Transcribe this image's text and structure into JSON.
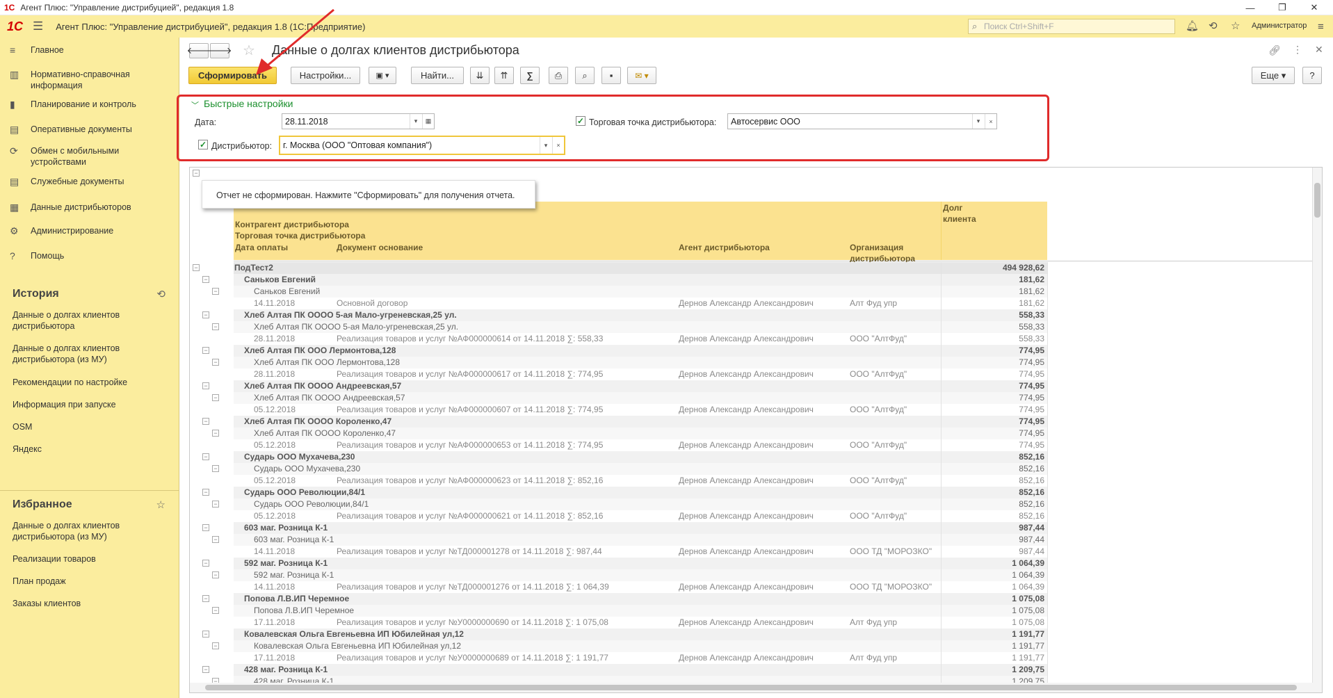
{
  "window": {
    "title": "Агент Плюс: \"Управление дистрибуцией\", редакция 1.8",
    "minimize": "—",
    "restore": "❐",
    "close": "✕"
  },
  "appbar": {
    "logo": "1С",
    "title": "Агент Плюс: \"Управление дистрибуцией\", редакция 1.8  (1С:Предприятие)",
    "search_placeholder": "Поиск Ctrl+Shift+F",
    "user": "Администратор"
  },
  "sidebar": {
    "nav": [
      {
        "label": "Главное",
        "icon": "≡"
      },
      {
        "label": "Нормативно-справочная информация",
        "icon": "▥"
      },
      {
        "label": "Планирование и контроль",
        "icon": "▮"
      },
      {
        "label": "Оперативные документы",
        "icon": "▤"
      },
      {
        "label": "Обмен с мобильными устройствами",
        "icon": "⟳"
      },
      {
        "label": "Служебные документы",
        "icon": "▤"
      },
      {
        "label": "Данные дистрибьюторов",
        "icon": "▦"
      },
      {
        "label": "Администрирование",
        "icon": "⚙"
      },
      {
        "label": "Помощь",
        "icon": "?"
      }
    ],
    "history_title": "История",
    "history": [
      "Данные о долгах клиентов дистрибьютора",
      "Данные о долгах клиентов дистрибьютора (из МУ)",
      "Рекомендации по настройке",
      "Информация при запуске",
      "OSM",
      "Яндекс"
    ],
    "favorites_title": "Избранное",
    "favorites": [
      "Данные о долгах клиентов дистрибьютора (из МУ)",
      "Реализации товаров",
      "План продаж",
      "Заказы клиентов"
    ]
  },
  "page": {
    "title": "Данные о долгах клиентов дистрибьютора",
    "btn_generate": "Сформировать",
    "btn_settings": "Настройки...",
    "btn_find": "Найти...",
    "btn_more": "Еще",
    "btn_help": "?"
  },
  "quick": {
    "title": "Быстрые настройки",
    "date_label": "Дата:",
    "date_value": "28.11.2018",
    "outlet_label": "Торговая точка дистрибьютора:",
    "outlet_value": "Автосервис ООО",
    "distributor_label": "Дистрибьютор:",
    "distributor_value": "г. Москва  (ООО \"Оптовая компания\")"
  },
  "report": {
    "tooltip": "Отчет не сформирован. Нажмите \"Сформировать\" для получения отчета.",
    "headers": {
      "h1": "Контрагент дистрибьютора",
      "h2": "Торговая точка дистрибьютора",
      "h3": "Дата оплаты",
      "h4": "Документ основание",
      "h5": "Агент дистрибьютора",
      "h6": "Организация дистрибьютора",
      "h7": "Долг клиента"
    },
    "rows": [
      {
        "lvl": 0,
        "c1": "ПодТест2",
        "c2": "",
        "c3": "",
        "c4": "",
        "amt": "494 928,62"
      },
      {
        "lvl": 1,
        "c1": "Саньков Евгений",
        "c2": "",
        "c3": "",
        "c4": "",
        "amt": "181,62"
      },
      {
        "lvl": 2,
        "c1": "Саньков Евгений",
        "c2": "",
        "c3": "",
        "c4": "",
        "amt": "181,62"
      },
      {
        "lvl": 3,
        "c1": "14.11.2018",
        "c2": "Основной договор",
        "c3": "Дернов Александр Александрович",
        "c4": "Алт Фуд упр",
        "amt": "181,62"
      },
      {
        "lvl": 1,
        "c1": "Хлеб Алтая ПК ОООО 5-ая Мало-угреневская,25 ул.",
        "c2": "",
        "c3": "",
        "c4": "",
        "amt": "558,33"
      },
      {
        "lvl": 2,
        "c1": "Хлеб Алтая ПК ОООО 5-ая Мало-угреневская,25 ул.",
        "c2": "",
        "c3": "",
        "c4": "",
        "amt": "558,33"
      },
      {
        "lvl": 3,
        "c1": "28.11.2018",
        "c2": "Реализация товаров и услуг №АФ000000614 от 14.11.2018 ∑: 558,33",
        "c3": "Дернов Александр Александрович",
        "c4": "ООО \"АлтФуд\"",
        "amt": "558,33"
      },
      {
        "lvl": 1,
        "c1": "Хлеб Алтая ПК ООО Лермонтова,128",
        "c2": "",
        "c3": "",
        "c4": "",
        "amt": "774,95"
      },
      {
        "lvl": 2,
        "c1": "Хлеб Алтая ПК ООО Лермонтова,128",
        "c2": "",
        "c3": "",
        "c4": "",
        "amt": "774,95"
      },
      {
        "lvl": 3,
        "c1": "28.11.2018",
        "c2": "Реализация товаров и услуг №АФ000000617 от 14.11.2018 ∑: 774,95",
        "c3": "Дернов Александр Александрович",
        "c4": "ООО \"АлтФуд\"",
        "amt": "774,95"
      },
      {
        "lvl": 1,
        "c1": "Хлеб Алтая ПК ОООО Андреевская,57",
        "c2": "",
        "c3": "",
        "c4": "",
        "amt": "774,95"
      },
      {
        "lvl": 2,
        "c1": "Хлеб Алтая ПК ОООО Андреевская,57",
        "c2": "",
        "c3": "",
        "c4": "",
        "amt": "774,95"
      },
      {
        "lvl": 3,
        "c1": "05.12.2018",
        "c2": "Реализация товаров и услуг №АФ000000607 от 14.11.2018 ∑: 774,95",
        "c3": "Дернов Александр Александрович",
        "c4": "ООО \"АлтФуд\"",
        "amt": "774,95"
      },
      {
        "lvl": 1,
        "c1": "Хлеб Алтая ПК ОООО Короленко,47",
        "c2": "",
        "c3": "",
        "c4": "",
        "amt": "774,95"
      },
      {
        "lvl": 2,
        "c1": "Хлеб Алтая ПК ОООО Короленко,47",
        "c2": "",
        "c3": "",
        "c4": "",
        "amt": "774,95"
      },
      {
        "lvl": 3,
        "c1": "05.12.2018",
        "c2": "Реализация товаров и услуг №АФ000000653 от 14.11.2018 ∑: 774,95",
        "c3": "Дернов Александр Александрович",
        "c4": "ООО \"АлтФуд\"",
        "amt": "774,95"
      },
      {
        "lvl": 1,
        "c1": "Сударь ООО Мухачева,230",
        "c2": "",
        "c3": "",
        "c4": "",
        "amt": "852,16"
      },
      {
        "lvl": 2,
        "c1": "Сударь ООО Мухачева,230",
        "c2": "",
        "c3": "",
        "c4": "",
        "amt": "852,16"
      },
      {
        "lvl": 3,
        "c1": "05.12.2018",
        "c2": "Реализация товаров и услуг №АФ000000623 от 14.11.2018 ∑: 852,16",
        "c3": "Дернов Александр Александрович",
        "c4": "ООО \"АлтФуд\"",
        "amt": "852,16"
      },
      {
        "lvl": 1,
        "c1": "Сударь ООО Революции,84/1",
        "c2": "",
        "c3": "",
        "c4": "",
        "amt": "852,16"
      },
      {
        "lvl": 2,
        "c1": "Сударь ООО Революции,84/1",
        "c2": "",
        "c3": "",
        "c4": "",
        "amt": "852,16"
      },
      {
        "lvl": 3,
        "c1": "05.12.2018",
        "c2": "Реализация товаров и услуг №АФ000000621 от 14.11.2018 ∑: 852,16",
        "c3": "Дернов Александр Александрович",
        "c4": "ООО \"АлтФуд\"",
        "amt": "852,16"
      },
      {
        "lvl": 1,
        "c1": "603 маг. Розница К-1",
        "c2": "",
        "c3": "",
        "c4": "",
        "amt": "987,44"
      },
      {
        "lvl": 2,
        "c1": "603 маг. Розница К-1",
        "c2": "",
        "c3": "",
        "c4": "",
        "amt": "987,44"
      },
      {
        "lvl": 3,
        "c1": "14.11.2018",
        "c2": "Реализация товаров и услуг №ТД000001278 от 14.11.2018 ∑: 987,44",
        "c3": "Дернов Александр Александрович",
        "c4": "ООО ТД \"МОРОЗКО\"",
        "amt": "987,44"
      },
      {
        "lvl": 1,
        "c1": "592 маг. Розница К-1",
        "c2": "",
        "c3": "",
        "c4": "",
        "amt": "1 064,39"
      },
      {
        "lvl": 2,
        "c1": "592 маг. Розница К-1",
        "c2": "",
        "c3": "",
        "c4": "",
        "amt": "1 064,39"
      },
      {
        "lvl": 3,
        "c1": "14.11.2018",
        "c2": "Реализация товаров и услуг №ТД000001276 от 14.11.2018 ∑: 1 064,39",
        "c3": "Дернов Александр Александрович",
        "c4": "ООО ТД \"МОРОЗКО\"",
        "amt": "1 064,39"
      },
      {
        "lvl": 1,
        "c1": "Попова Л.В.ИП Черемное",
        "c2": "",
        "c3": "",
        "c4": "",
        "amt": "1 075,08"
      },
      {
        "lvl": 2,
        "c1": "Попова Л.В.ИП Черемное",
        "c2": "",
        "c3": "",
        "c4": "",
        "amt": "1 075,08"
      },
      {
        "lvl": 3,
        "c1": "17.11.2018",
        "c2": "Реализация товаров и услуг №У0000000690 от 14.11.2018 ∑: 1 075,08",
        "c3": "Дернов Александр Александрович",
        "c4": "Алт Фуд упр",
        "amt": "1 075,08"
      },
      {
        "lvl": 1,
        "c1": "Ковалевская Ольга Евгеньевна ИП Юбилейная ул,12",
        "c2": "",
        "c3": "",
        "c4": "",
        "amt": "1 191,77"
      },
      {
        "lvl": 2,
        "c1": "Ковалевская Ольга Евгеньевна ИП Юбилейная ул,12",
        "c2": "",
        "c3": "",
        "c4": "",
        "amt": "1 191,77"
      },
      {
        "lvl": 3,
        "c1": "17.11.2018",
        "c2": "Реализация товаров и услуг №У0000000689 от 14.11.2018 ∑: 1 191,77",
        "c3": "Дернов Александр Александрович",
        "c4": "Алт Фуд упр",
        "amt": "1 191,77"
      },
      {
        "lvl": 1,
        "c1": "428 маг. Розница К-1",
        "c2": "",
        "c3": "",
        "c4": "",
        "amt": "1 209,75"
      },
      {
        "lvl": 2,
        "c1": "428 маг. Розница К-1",
        "c2": "",
        "c3": "",
        "c4": "",
        "amt": "1 209,75"
      }
    ]
  },
  "colors": {
    "accent": "#fbed9e",
    "header_bg": "#fbe290",
    "generate_btn": "#f5d13a",
    "highlight": "#e02b2b"
  }
}
